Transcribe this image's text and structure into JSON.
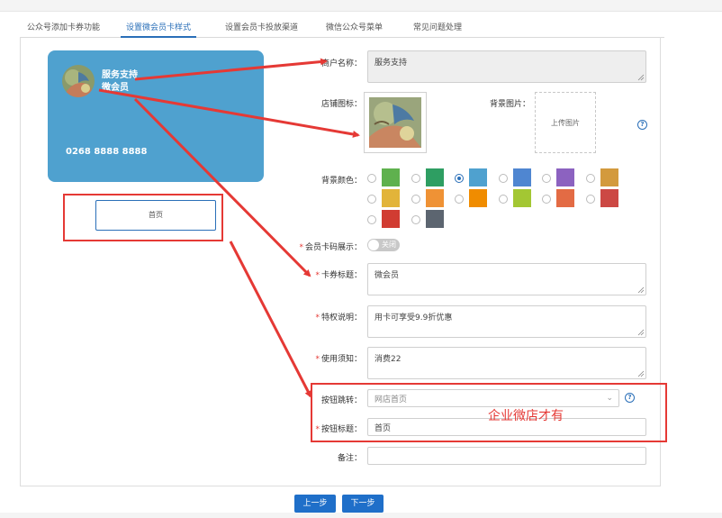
{
  "tabs": [
    {
      "label": "公众号添加卡券功能"
    },
    {
      "label": "设置微会员卡样式"
    },
    {
      "label": "设置会员卡投放渠道"
    },
    {
      "label": "微信公众号菜单"
    },
    {
      "label": "常见问题处理"
    }
  ],
  "card": {
    "name_line1": "服务支持",
    "name_line2": "微会员",
    "number": "0268 8888 8888",
    "color": "#4fa1cf"
  },
  "preview": {
    "button_label": "首页"
  },
  "form": {
    "merchant_name": {
      "label": "商户名称：",
      "value": "服务支持"
    },
    "shop_icon": {
      "label": "店铺图标："
    },
    "bg_image": {
      "label": "背景图片：",
      "upload_text": "上传图片"
    },
    "bg_color": {
      "label": "背景颜色：",
      "selected_index": 2,
      "colors": [
        "#5fb14e",
        "#2e9e62",
        "#4fa1cf",
        "#4f86d1",
        "#8c62c0",
        "#d39a3d",
        "#e2b43a",
        "#ef9235",
        "#f08c00",
        "#a3c733",
        "#e36b44",
        "#cc4844",
        "#d13c32",
        "#5c6570"
      ]
    },
    "member_code": {
      "label": "会员卡码展示：",
      "toggle_text": "关闭"
    },
    "card_title": {
      "label": "卡券标题：",
      "value": "微会员"
    },
    "privilege": {
      "label": "特权说明：",
      "value": "用卡可享受9.9折优惠"
    },
    "notice": {
      "label": "使用须知：",
      "value": "消费22"
    },
    "button_jump": {
      "label": "按钮跳转：",
      "value": "网店首页"
    },
    "button_title": {
      "label": "按钮标题：",
      "value": "首页"
    },
    "remark": {
      "label": "备注：",
      "value": ""
    }
  },
  "annotation": "企业微店才有",
  "buttons": {
    "prev": "上一步",
    "next": "下一步"
  },
  "colors": {
    "accent": "#2a6fb8",
    "annotation": "#e53935"
  }
}
